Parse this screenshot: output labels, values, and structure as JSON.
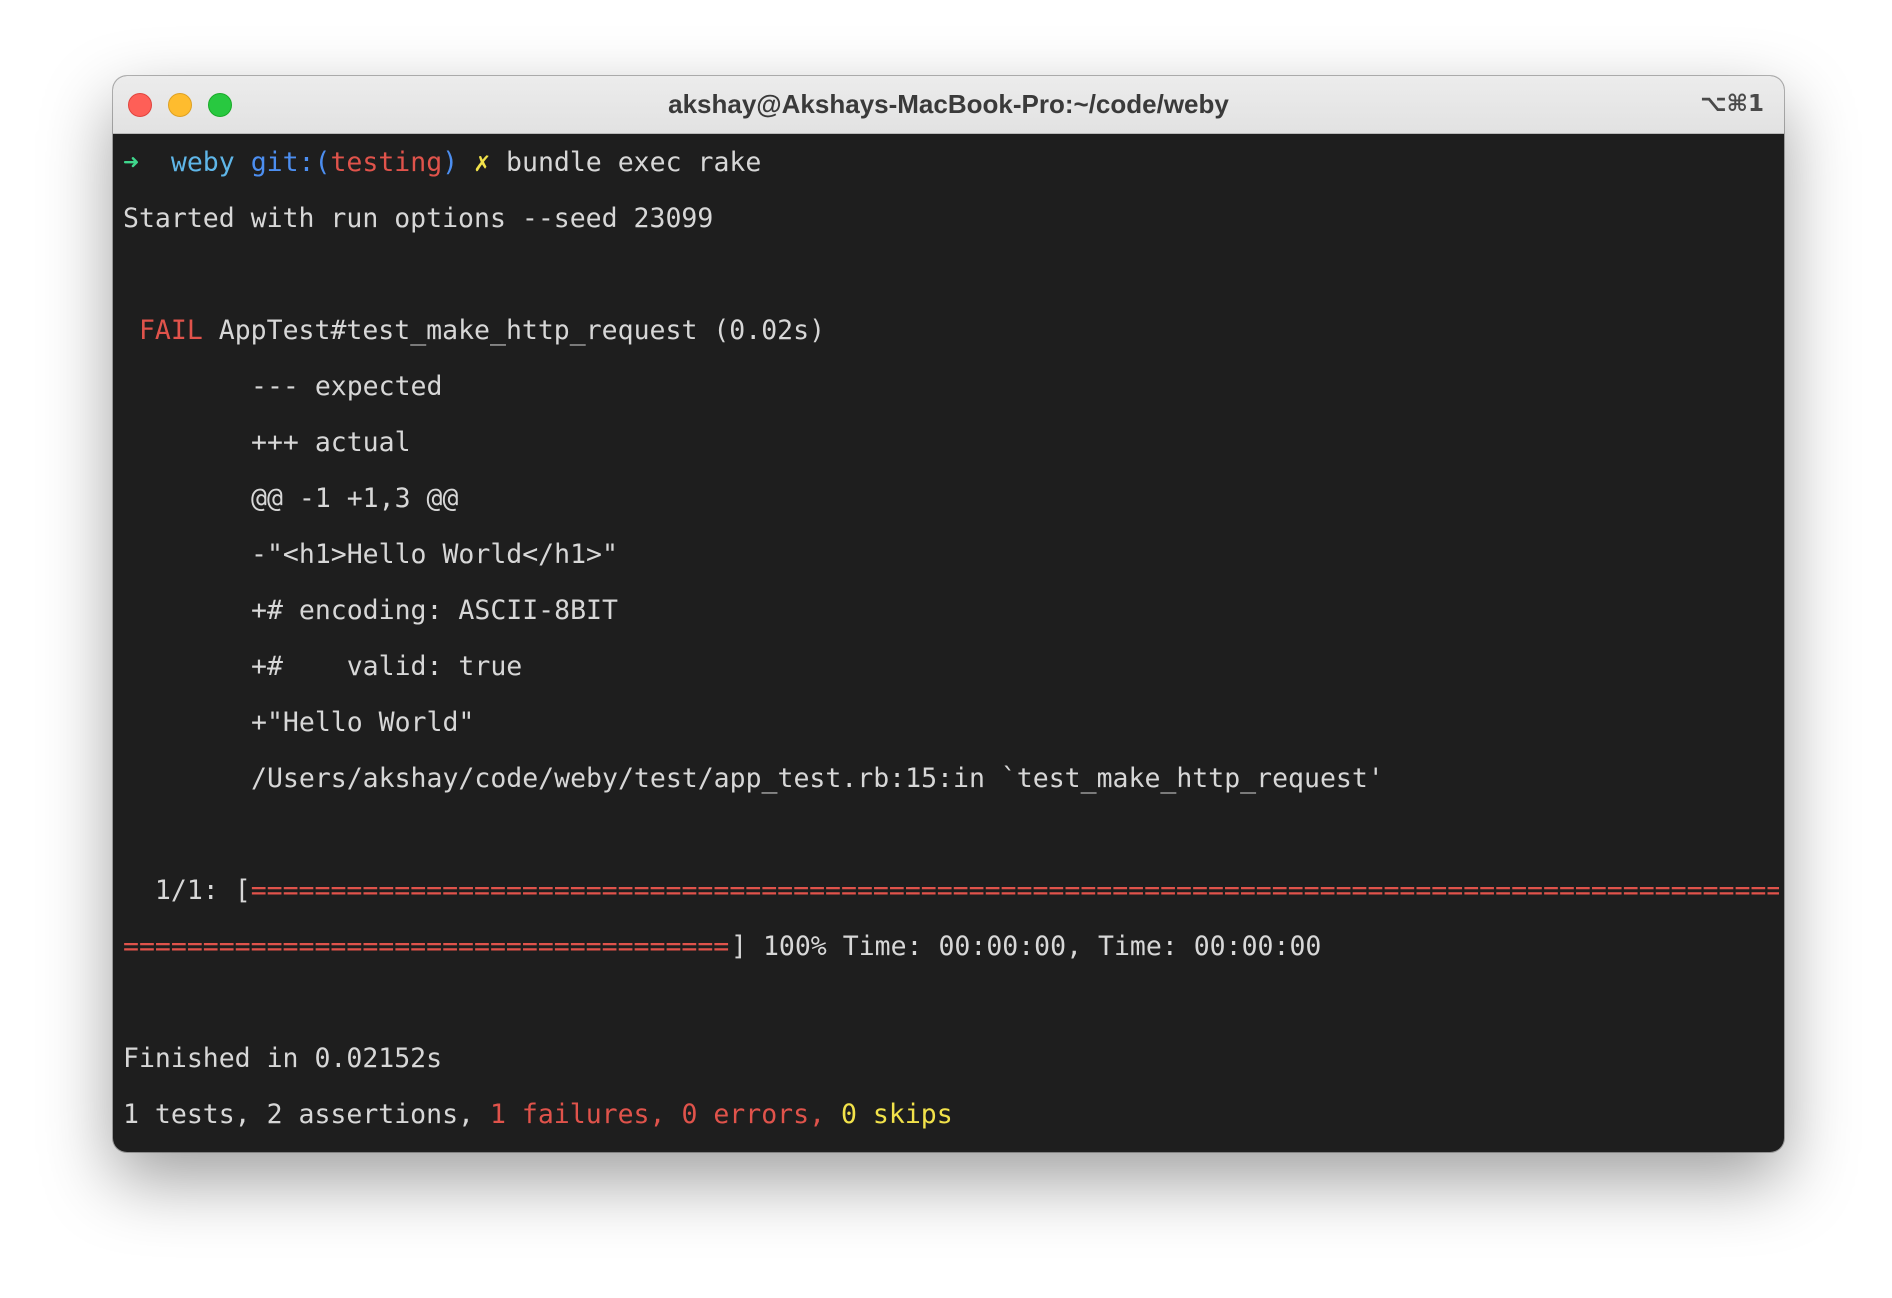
{
  "window": {
    "title": "akshay@Akshays-MacBook-Pro:~/code/weby",
    "shortcut": "⌥⌘1"
  },
  "prompt": {
    "arrow": "➜",
    "directory": "weby",
    "git_prefix": "git:(",
    "branch": "testing",
    "git_suffix": ")",
    "dirty_mark": "✗",
    "command": "bundle exec rake"
  },
  "output": {
    "started": "Started with run options --seed 23099",
    "fail_label": "FAIL",
    "fail_test": "AppTest#test_make_http_request (0.02s)",
    "diff_lines": [
      "--- expected",
      "+++ actual",
      "@@ -1 +1,3 @@",
      "-\"<h1>Hello World</h1>\"",
      "+# encoding: ASCII-8BIT",
      "+#    valid: true",
      "+\"Hello World\"",
      "/Users/akshay/code/weby/test/app_test.rb:15:in `test_make_http_request'"
    ],
    "progress": {
      "count": "1/1:",
      "open_bracket": "[",
      "bar_line1": "================================================================================================",
      "bar_line2": "======================================",
      "close_bracket": "]",
      "percent": 100,
      "percent_text": "100%",
      "time_text": "Time: 00:00:00, Time: 00:00:00"
    },
    "finished": "Finished in 0.02152s",
    "summary": {
      "tests": "1 tests, 2 assertions,",
      "failures": "1 failures,",
      "errors": "0 errors,",
      "skips": "0 skips"
    }
  },
  "colors": {
    "background": "#1e1e1e",
    "text": "#d7d7d7",
    "prompt_arrow": "#3fd68c",
    "directory": "#5fb6e8",
    "git": "#4c8ef0",
    "error_red": "#e0534b",
    "warning_yellow": "#f2e24a"
  }
}
